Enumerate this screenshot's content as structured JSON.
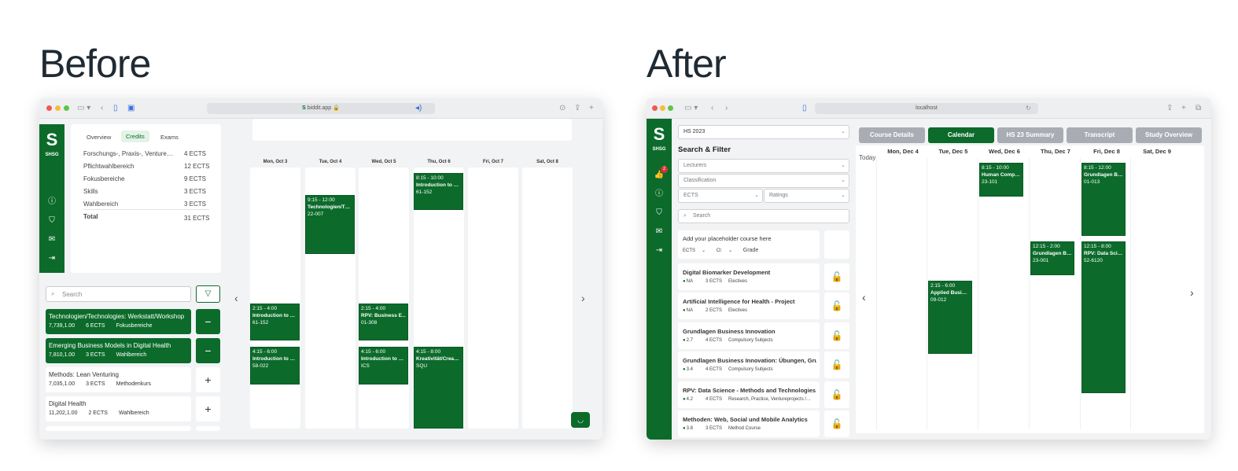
{
  "headings": {
    "before": "Before",
    "after": "After"
  },
  "before": {
    "url": "biddit.app",
    "brand": "SHSG",
    "tabs": [
      "Overview",
      "Credits",
      "Exams"
    ],
    "credits": [
      {
        "label": "Forschungs-, Praxis-, Venture…",
        "value": "4 ECTS"
      },
      {
        "label": "Pflichtwahlbereich",
        "value": "12 ECTS"
      },
      {
        "label": "Fokusbereiche",
        "value": "9 ECTS"
      },
      {
        "label": "Skills",
        "value": "3 ECTS"
      },
      {
        "label": "Wahlbereich",
        "value": "3 ECTS"
      }
    ],
    "total": {
      "label": "Total",
      "value": "31 ECTS"
    },
    "search_placeholder": "Search",
    "courses": [
      {
        "title": "Technologien/Technologies: Werkstatt/Workshop",
        "code": "7,739,1.00",
        "ects": "6 ECTS",
        "area": "Fokusbereiche",
        "selected": true,
        "action": "−"
      },
      {
        "title": "Emerging Business Models in Digital Health",
        "code": "7,810,1.00",
        "ects": "3 ECTS",
        "area": "Wahlbereich",
        "selected": true,
        "action": "−"
      },
      {
        "title": "Methods: Lean Venturing",
        "code": "7,035,1.00",
        "ects": "3 ECTS",
        "area": "Methodenkurs",
        "selected": false,
        "action": "+"
      },
      {
        "title": "Digital Health",
        "code": "11,202,1.00",
        "ects": "2 ECTS",
        "area": "Wahlbereich",
        "selected": false,
        "action": "+"
      }
    ],
    "days": [
      "Mon, Oct 3",
      "Tue, Oct 4",
      "Wed, Oct 5",
      "Thu, Oct 6",
      "Fri, Oct 7",
      "Sat, Oct 8"
    ],
    "events": [
      {
        "day": 1,
        "time": "9:15 - 12:00",
        "title": "Technologien/T…",
        "room": "22-007"
      },
      {
        "day": 3,
        "time": "8:15 - 10:00",
        "title": "Introduction to …",
        "room": "61-152"
      },
      {
        "day": 0,
        "time": "2:15 - 4:00",
        "title": "Introduction to …",
        "room": "61-152"
      },
      {
        "day": 2,
        "time": "2:15 - 4:00",
        "title": "RPV: Business E…",
        "room": "01-308"
      },
      {
        "day": 0,
        "time": "4:15 - 6:00",
        "title": "Introduction to …",
        "room": "58-022"
      },
      {
        "day": 2,
        "time": "4:15 - 6:00",
        "title": "Introduction to …",
        "room": "ICS"
      },
      {
        "day": 3,
        "time": "4:15 - 8:00",
        "title": "Kreativität/Crea…",
        "room": "SQU"
      }
    ]
  },
  "after": {
    "url": "localhost",
    "brand": "SHSG",
    "badge": "2",
    "semester": "HS 2023",
    "search_filter_title": "Search & Filter",
    "filters": {
      "lecturers": "Lecturers",
      "classification": "Classification",
      "ects": "ECTS",
      "ratings": "Ratings",
      "search": "Search"
    },
    "placeholder_card": {
      "title": "Add your placeholder course here",
      "ects": "ECTS",
      "cl": "Cl:",
      "grade": "Grade"
    },
    "courses": [
      {
        "title": "Digital Biomarker Development",
        "rating": "NA",
        "ects": "3 ECTS",
        "area": "Electives"
      },
      {
        "title": "Artificial Intelligence for Health - Project",
        "rating": "NA",
        "ects": "2 ECTS",
        "area": "Electives"
      },
      {
        "title": "Grundlagen Business Innovation",
        "rating": "2.7",
        "ects": "4 ECTS",
        "area": "Compulsory Subjects"
      },
      {
        "title": "Grundlagen Business Innovation: Übungen, Gru…",
        "rating": "3.4",
        "ects": "4 ECTS",
        "area": "Compulsory Subjects"
      },
      {
        "title": "RPV: Data Science - Methods and Technologies…",
        "rating": "4.2",
        "ects": "4 ECTS",
        "area": "Research, Practice, Ventureprojects /…"
      },
      {
        "title": "Methoden: Web, Social und Mobile Analytics",
        "rating": "3.8",
        "ects": "3 ECTS",
        "area": "Method Course"
      }
    ],
    "tabs": [
      {
        "label": "Course Details",
        "active": false
      },
      {
        "label": "Calendar",
        "active": true
      },
      {
        "label": "HS 23 Summary",
        "active": false
      },
      {
        "label": "Transcript",
        "active": false
      },
      {
        "label": "Study Overview",
        "active": false
      }
    ],
    "today_label": "Today",
    "days": [
      "Mon, Dec 4",
      "Tue, Dec 5",
      "Wed, Dec 6",
      "Thu, Dec 7",
      "Fri, Dec 8",
      "Sat, Dec 9"
    ],
    "events": [
      {
        "day": 2,
        "time": "8:15 - 10:00",
        "title": "Human Comp…",
        "room": "23-101"
      },
      {
        "day": 4,
        "time": "8:15 - 12:00",
        "title": "Grundlagen B…",
        "room": "01-013"
      },
      {
        "day": 3,
        "time": "12:15 - 2:00",
        "title": "Grundlagen B…",
        "room": "23-001"
      },
      {
        "day": 4,
        "time": "12:15 - 8:00",
        "title": "RPV: Data Sci…",
        "room": "52-6120"
      },
      {
        "day": 1,
        "time": "2:15 - 6:00",
        "title": "Applied Busi…",
        "room": "09-012"
      }
    ]
  }
}
